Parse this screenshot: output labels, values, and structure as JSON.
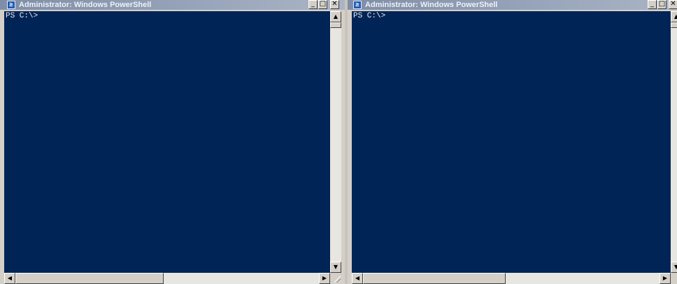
{
  "windows": [
    {
      "title": "Administrator: Windows PowerShell",
      "console_lines": [
        "PS C:\\>"
      ],
      "caption_buttons": {
        "minimize": "_",
        "maximize": "□",
        "close": "✕"
      }
    },
    {
      "title": "Administrator: Windows PowerShell",
      "console_lines": [
        "PS C:\\>"
      ],
      "caption_buttons": {
        "minimize": "_",
        "maximize": "□",
        "close": "✕"
      }
    }
  ],
  "icons": {
    "app": "powershell-icon",
    "scroll_up": "▲",
    "scroll_down": "▼",
    "scroll_left": "◀",
    "scroll_right": "▶",
    "ps_glyph": "≥"
  },
  "colors": {
    "console_background": "#012456",
    "console_text": "#eeedf0",
    "titlebar_inactive": "#7f8ea8",
    "window_face": "#d4d0c8"
  }
}
